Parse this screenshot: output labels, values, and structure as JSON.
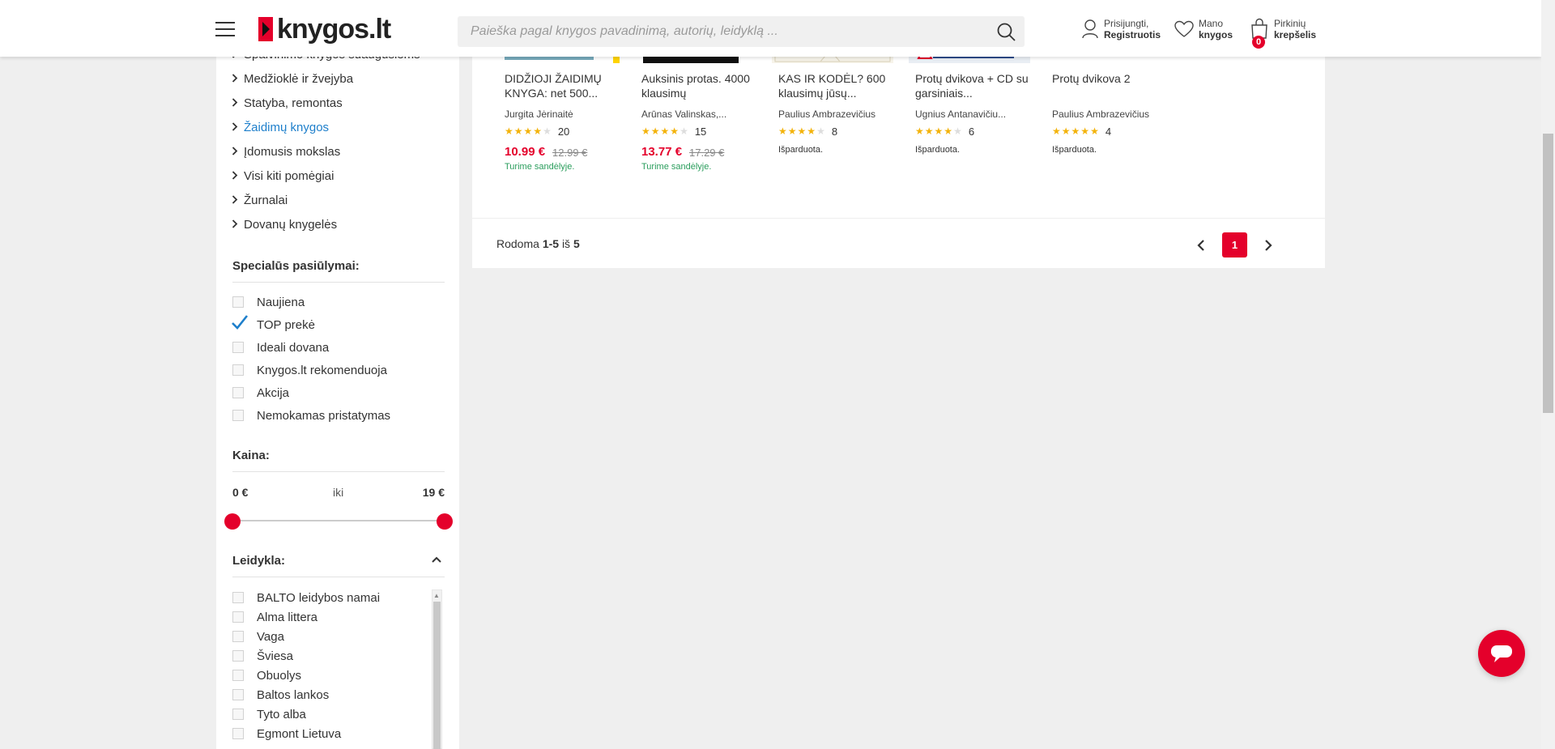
{
  "header": {
    "logo_text": "knygos.lt",
    "search_placeholder": "Paieška pagal knygos pavadinimą, autorių, leidyklą ...",
    "login_line1": "Prisijungti,",
    "login_line2": "Registruotis",
    "wishlist_line1": "Mano",
    "wishlist_line2": "knygos",
    "cart_line1": "Pirkinių",
    "cart_line2": "krepšelis",
    "cart_count": "0"
  },
  "sidebar": {
    "categories": [
      {
        "label": "Spalvinimo knygos suaugusiems"
      },
      {
        "label": "Medžioklė ir žvejyba"
      },
      {
        "label": "Statyba, remontas"
      },
      {
        "label": "Žaidimų knygos",
        "active": true
      },
      {
        "label": "Įdomusis mokslas"
      },
      {
        "label": "Visi kiti pomėgiai"
      },
      {
        "label": "Žurnalai"
      },
      {
        "label": "Dovanų knygelės"
      }
    ],
    "special_title": "Specialūs pasiūlymai:",
    "special_offers": [
      {
        "label": "Naujiena",
        "checked": false
      },
      {
        "label": "TOP prekė",
        "checked": true
      },
      {
        "label": "Ideali dovana",
        "checked": false
      },
      {
        "label": "Knygos.lt rekomenduoja",
        "checked": false
      },
      {
        "label": "Akcija",
        "checked": false
      },
      {
        "label": "Nemokamas pristatymas",
        "checked": false
      }
    ],
    "price_title": "Kaina:",
    "price_from": "0 €",
    "price_mid": "iki",
    "price_to": "19 €",
    "price_range_fraction": [
      0,
      1
    ],
    "publisher_title": "Leidykla:",
    "publishers": [
      {
        "label": "BALTO leidybos namai"
      },
      {
        "label": "Alma littera"
      },
      {
        "label": "Vaga"
      },
      {
        "label": "Šviesa"
      },
      {
        "label": "Obuolys"
      },
      {
        "label": "Baltos lankos"
      },
      {
        "label": "Tyto alba"
      },
      {
        "label": "Egmont Lietuva"
      }
    ]
  },
  "products": [
    {
      "title": "DIDŽIOJI ŽAIDIMŲ KNYGA: net 500...",
      "author": "Jurgita Jėrinaitė",
      "rating": 4,
      "count": "20",
      "price": "10.99 €",
      "old_price": "12.99 €",
      "stock": "Turime sandėlyje."
    },
    {
      "title": "Auksinis protas. 4000 klausimų",
      "author": "Arūnas Valinskas,...",
      "rating": 4,
      "count": "15",
      "price": "13.77 €",
      "old_price": "17.29 €",
      "stock": "Turime sandėlyje."
    },
    {
      "title": "KAS IR KODĖL? 600 klausimų jūsų...",
      "author": "Paulius Ambrazevičius",
      "rating": 4,
      "count": "8",
      "sold": "Išparduota."
    },
    {
      "title": "Protų dvikova + CD su garsiniais...",
      "author": "Ugnius Antanavičiu...",
      "rating": 4,
      "count": "6",
      "sold": "Išparduota."
    },
    {
      "title": "Protų dvikova 2",
      "author": "Paulius Ambrazevičius",
      "rating": 5,
      "count": "4",
      "sold": "Išparduota."
    }
  ],
  "pagination": {
    "showing_prefix": "Rodoma",
    "range": "1-5",
    "of": "iš",
    "total": "5",
    "current_page": "1"
  },
  "colors": {
    "accent": "#e4002b",
    "link": "#1e7fcb",
    "stock": "#2a9d5c",
    "star": "#f3b30c"
  }
}
